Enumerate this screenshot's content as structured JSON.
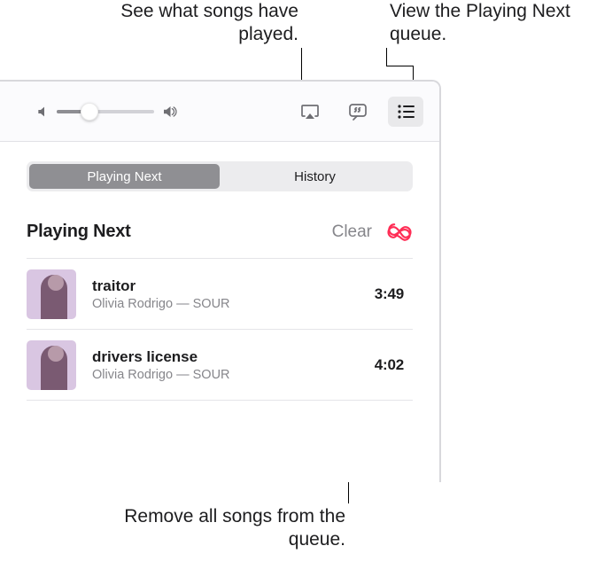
{
  "annotations": {
    "history": "See what songs have played.",
    "queue_btn": "View the Playing Next queue.",
    "clear": "Remove all songs from the queue."
  },
  "toolbar": {
    "volume_percent": 35
  },
  "segmented": {
    "playing_next": "Playing Next",
    "history": "History"
  },
  "section": {
    "title": "Playing Next",
    "clear": "Clear"
  },
  "songs": [
    {
      "title": "traitor",
      "artist": "Olivia Rodrigo",
      "album": "SOUR",
      "duration": "3:49"
    },
    {
      "title": "drivers license",
      "artist": "Olivia Rodrigo",
      "album": "SOUR",
      "duration": "4:02"
    }
  ],
  "separator": "—"
}
